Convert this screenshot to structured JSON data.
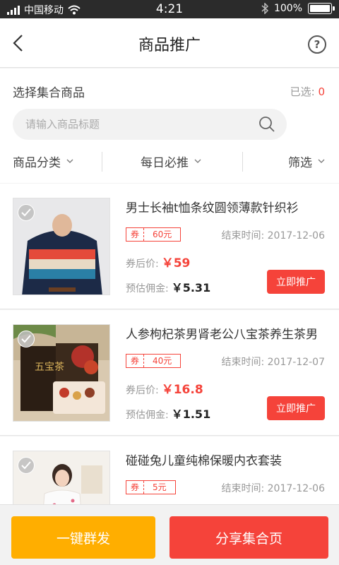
{
  "status_bar": {
    "carrier": "中国移动",
    "time": "4:21",
    "battery": "100%"
  },
  "header": {
    "title": "商品推广",
    "help": "?"
  },
  "select": {
    "title": "选择集合商品",
    "selected_label": "已选:",
    "selected_count": "0"
  },
  "search": {
    "placeholder": "请输入商品标题"
  },
  "filters": [
    {
      "label": "商品分类"
    },
    {
      "label": "每日必推"
    },
    {
      "label": "筛选"
    }
  ],
  "products": [
    {
      "name": "男士长袖t恤条纹圆领薄款针织衫",
      "coupon_label": "券",
      "coupon_value": "60元",
      "end_time": "结束时间: 2017-12-06",
      "after_price_label": "券后价:",
      "after_price": "￥59",
      "commission_label": "预估佣金:",
      "commission": "￥5.31",
      "promote_label": "立即推广"
    },
    {
      "name": "人参枸杞茶男肾老公八宝茶养生茶男",
      "coupon_label": "券",
      "coupon_value": "40元",
      "end_time": "结束时间: 2017-12-07",
      "after_price_label": "券后价:",
      "after_price": "￥16.8",
      "commission_label": "预估佣金:",
      "commission": "￥1.51",
      "promote_label": "立即推广"
    },
    {
      "name": "碰碰兔儿童纯棉保暖内衣套装",
      "coupon_label": "券",
      "coupon_value": "5元",
      "end_time": "结束时间: 2017-12-06"
    }
  ],
  "bottom": {
    "mass_send": "一键群发",
    "share": "分享集合页"
  },
  "colors": {
    "accent_red": "#f5433a",
    "accent_orange": "#ffae00"
  }
}
